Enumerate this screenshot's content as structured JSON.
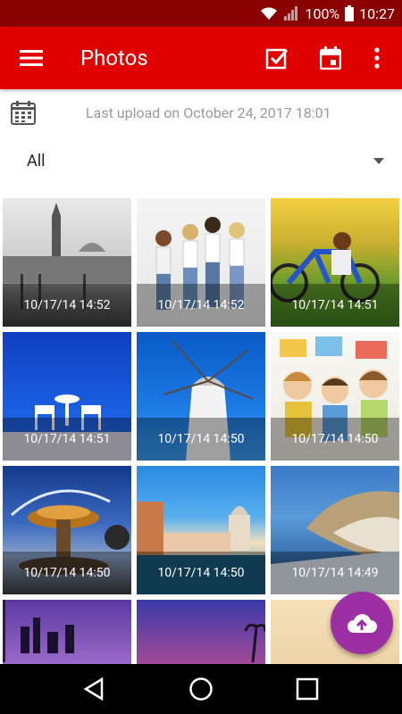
{
  "status": {
    "battery": "100%",
    "time": "10:27"
  },
  "app_bar": {
    "title": "Photos"
  },
  "upload": {
    "text": "Last upload on October 24, 2017 18:01"
  },
  "filter": {
    "selected": "All"
  },
  "photos": [
    {
      "time": "10/17/14 14:52"
    },
    {
      "time": "10/17/14 14:52"
    },
    {
      "time": "10/17/14 14:51"
    },
    {
      "time": "10/17/14 14:51"
    },
    {
      "time": "10/17/14 14:50"
    },
    {
      "time": "10/17/14 14:50"
    },
    {
      "time": "10/17/14 14:50"
    },
    {
      "time": "10/17/14 14:50"
    },
    {
      "time": "10/17/14 14:49"
    }
  ],
  "colors": {
    "app_bar": "#e00000",
    "status_bar": "#8b0000",
    "fab": "#9c2fa4"
  },
  "icons": {
    "menu": "menu-icon",
    "select": "check-square-icon",
    "calendar": "calendar-icon",
    "more": "more-vert-icon",
    "upload": "cloud-upload-icon"
  }
}
